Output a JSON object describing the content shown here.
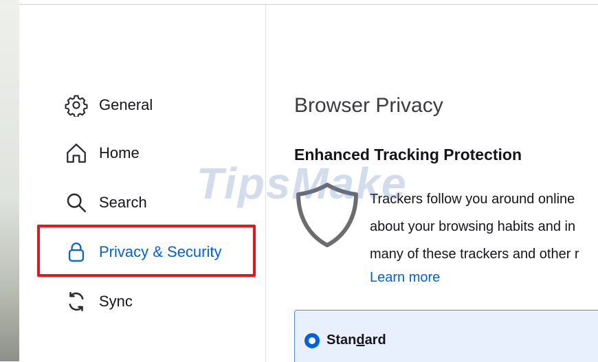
{
  "sidebar": {
    "items": [
      {
        "label": "General",
        "icon": "gear-icon",
        "active": false
      },
      {
        "label": "Home",
        "icon": "home-icon",
        "active": false
      },
      {
        "label": "Search",
        "icon": "search-icon",
        "active": false
      },
      {
        "label": "Privacy & Security",
        "icon": "lock-icon",
        "active": true
      },
      {
        "label": "Sync",
        "icon": "sync-icon",
        "active": false
      }
    ]
  },
  "main": {
    "page_title": "Browser Privacy",
    "section_title": "Enhanced Tracking Protection",
    "description_lines": [
      "Trackers follow you around online",
      "about your browsing habits and in",
      "many of these trackers and other r"
    ],
    "learn_more": "Learn more",
    "standard_option": {
      "label_before": "Stan",
      "label_mnemonic": "d",
      "label_after": "ard",
      "selected": true
    }
  },
  "watermark": "TipsMake",
  "colors": {
    "accent": "#0061e0",
    "highlight_box": "#e3171c",
    "selected_card_bg": "#e8f0fe",
    "text": "#15141a"
  }
}
